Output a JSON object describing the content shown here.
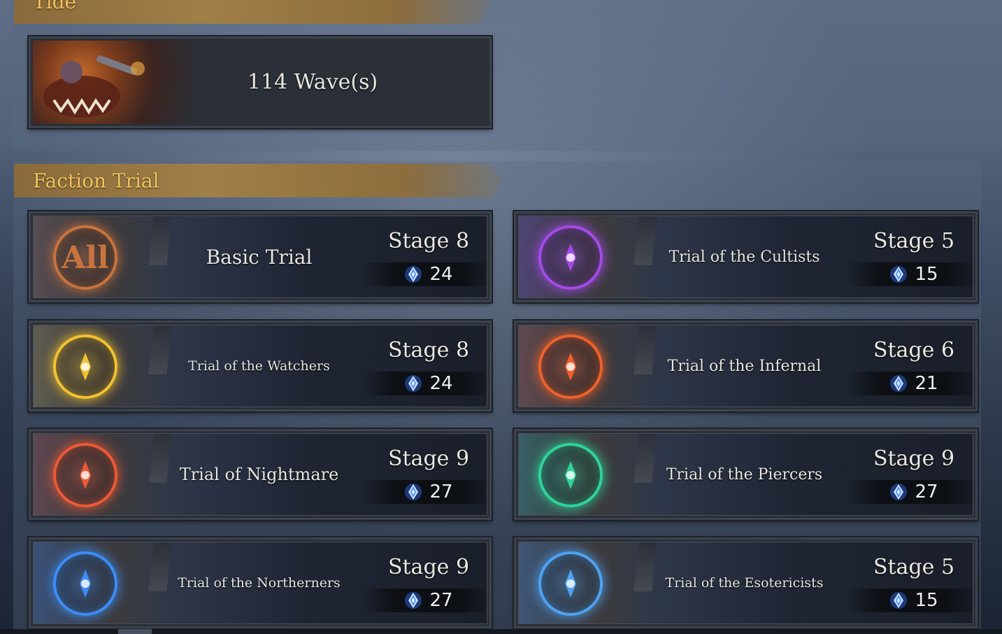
{
  "top_section": {
    "banner_text": "Tide",
    "wave_text": "114 Wave(s)"
  },
  "faction_section": {
    "title": "Faction Trial",
    "trials": [
      {
        "name": "Basic Trial",
        "stage": "Stage 8",
        "value": "24",
        "emblem": "all-emblem-icon",
        "emblem_text": "All",
        "color": "#c8733e"
      },
      {
        "name": "Trial of the Cultists",
        "stage": "Stage 5",
        "value": "15",
        "emblem": "cultist-emblem-icon",
        "color": "#a34be8"
      },
      {
        "name": "Trial of the Watchers",
        "stage": "Stage 8",
        "value": "24",
        "emblem": "watcher-emblem-icon",
        "color": "#f2c230"
      },
      {
        "name": "Trial of the Infernal",
        "stage": "Stage 6",
        "value": "21",
        "emblem": "infernal-emblem-icon",
        "color": "#f0612a"
      },
      {
        "name": "Trial of Nightmare",
        "stage": "Stage 9",
        "value": "27",
        "emblem": "nightmare-emblem-icon",
        "color": "#ec5a35"
      },
      {
        "name": "Trial of the Piercers",
        "stage": "Stage 9",
        "value": "27",
        "emblem": "piercer-emblem-icon",
        "color": "#2fd49a"
      },
      {
        "name": "Trial of the Northerners",
        "stage": "Stage 9",
        "value": "27",
        "emblem": "northerner-emblem-icon",
        "color": "#3c8df5"
      },
      {
        "name": "Trial of the Esotericists",
        "stage": "Stage 5",
        "value": "15",
        "emblem": "esotericist-emblem-icon",
        "color": "#4fa2f0"
      }
    ]
  },
  "currency_icon": "crystal-icon"
}
